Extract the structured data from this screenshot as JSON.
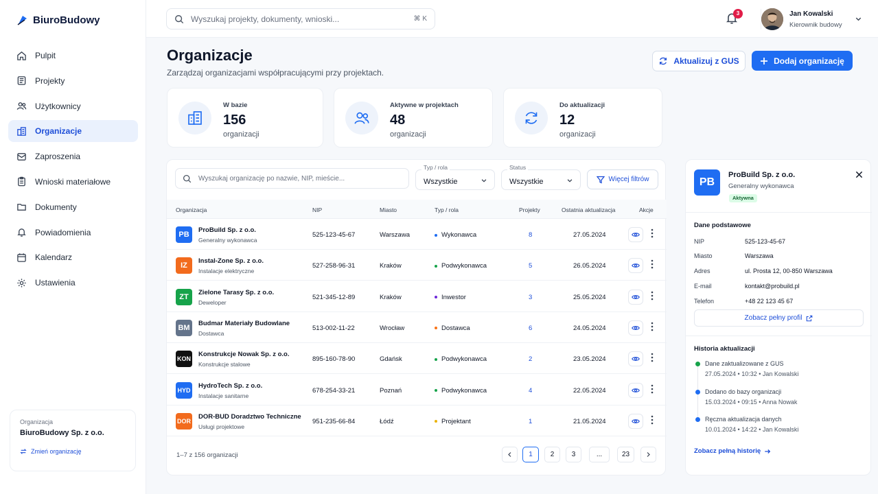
{
  "app": {
    "name": "BiuroBudowy"
  },
  "nav": {
    "items": [
      {
        "label": "Pulpit",
        "icon": "home-icon"
      },
      {
        "label": "Projekty",
        "icon": "projects-icon"
      },
      {
        "label": "Użytkownicy",
        "icon": "users-icon"
      },
      {
        "label": "Organizacje",
        "icon": "building-icon",
        "active": true
      },
      {
        "label": "Zaproszenia",
        "icon": "mail-icon"
      },
      {
        "label": "Wnioski materiałowe",
        "icon": "clipboard-icon"
      },
      {
        "label": "Dokumenty",
        "icon": "folder-icon"
      },
      {
        "label": "Powiadomienia",
        "icon": "bell-icon"
      },
      {
        "label": "Kalendarz",
        "icon": "calendar-icon"
      },
      {
        "label": "Ustawienia",
        "icon": "gear-icon"
      }
    ]
  },
  "org_switcher": {
    "label": "Organizacja",
    "name": "BiuroBudowy Sp. z o.o.",
    "change_label": "Zmień organizację"
  },
  "topbar": {
    "search_placeholder": "Wyszukaj projekty, dokumenty, wnioski...",
    "shortcut": "⌘ K",
    "notifications_count": "3",
    "user_name": "Jan Kowalski",
    "user_role": "Kierownik budowy"
  },
  "page": {
    "title": "Organizacje",
    "subtitle": "Zarządzaj organizacjami współpracującymi przy projektach.",
    "btn_gus": "Aktualizuj z GUS",
    "btn_add": "Dodaj organizację"
  },
  "stats": [
    {
      "label": "W bazie",
      "value": "156",
      "unit": "organizacji",
      "icon": "building-icon"
    },
    {
      "label": "Aktywne w projektach",
      "value": "48",
      "unit": "organizacji",
      "icon": "users-icon"
    },
    {
      "label": "Do aktualizacji",
      "value": "12",
      "unit": "organizacji",
      "icon": "refresh-icon"
    }
  ],
  "filters": {
    "search_placeholder": "Wyszukaj organizację po nazwie, NIP, mieście...",
    "type_caption": "Typ / rola",
    "type_value": "Wszystkie",
    "status_caption": "Status",
    "status_value": "Wszystkie",
    "more_label": "Więcej filtrów"
  },
  "table": {
    "headers": {
      "org": "Organizacja",
      "nip": "NIP",
      "city": "Miasto",
      "type": "Typ / rola",
      "projects": "Projekty",
      "updated": "Ostatnia aktualizacja",
      "actions": "Akcje"
    },
    "rows": [
      {
        "abbr": "PB",
        "color": "#1f6df2",
        "name": "ProBuild Sp. z o.o.",
        "sub": "Generalny wykonawca",
        "nip": "525-123-45-67",
        "city": "Warszawa",
        "type": "Wykonawca",
        "dot": "#1f6df2",
        "projects": "8",
        "date": "27.05.2024"
      },
      {
        "abbr": "IZ",
        "color": "#f26b1d",
        "name": "Instal-Zone Sp. z o.o.",
        "sub": "Instalacje elektryczne",
        "nip": "527-258-96-31",
        "city": "Kraków",
        "type": "Podwykonawca",
        "dot": "#16a34a",
        "projects": "5",
        "date": "26.05.2024"
      },
      {
        "abbr": "ZT",
        "color": "#16a34a",
        "name": "Zielone Tarasy Sp. z o.o.",
        "sub": "Deweloper",
        "nip": "521-345-12-89",
        "city": "Kraków",
        "type": "Inwestor",
        "dot": "#6d28d9",
        "projects": "3",
        "date": "25.05.2024"
      },
      {
        "abbr": "BM",
        "color": "#64748b",
        "name": "Budmar Materiały Budowlane",
        "sub": "Dostawca",
        "nip": "513-002-11-22",
        "city": "Wrocław",
        "type": "Dostawca",
        "dot": "#f97316",
        "projects": "6",
        "date": "24.05.2024"
      },
      {
        "abbr": "KON",
        "color": "#111111",
        "name": "Konstrukcje Nowak Sp. z o.o.",
        "sub": "Konstrukcje stalowe",
        "nip": "895-160-78-90",
        "city": "Gdańsk",
        "type": "Podwykonawca",
        "dot": "#16a34a",
        "projects": "2",
        "date": "23.05.2024"
      },
      {
        "abbr": "HYD",
        "color": "#1f6df2",
        "name": "HydroTech Sp. z o.o.",
        "sub": "Instalacje sanitarne",
        "nip": "678-254-33-21",
        "city": "Poznań",
        "type": "Podwykonawca",
        "dot": "#16a34a",
        "projects": "4",
        "date": "22.05.2024"
      },
      {
        "abbr": "DOR",
        "color": "#f26b1d",
        "name": "DOR-BUD Doradztwo Techniczne",
        "sub": "Usługi projektowe",
        "nip": "951-235-66-84",
        "city": "Łódź",
        "type": "Projektant",
        "dot": "#eab308",
        "projects": "1",
        "date": "21.05.2024"
      }
    ]
  },
  "pagination": {
    "info": "1–7 z 156 organizacji",
    "pages": [
      "1",
      "2",
      "3",
      "...",
      "23"
    ]
  },
  "detail": {
    "abbr": "PB",
    "name": "ProBuild Sp. z o.o.",
    "sub": "Generalny wykonawca",
    "status": "Aktywna",
    "basic_title": "Dane podstawowe",
    "fields": [
      {
        "k": "NIP",
        "v": "525-123-45-67"
      },
      {
        "k": "Miasto",
        "v": "Warszawa"
      },
      {
        "k": "Adres",
        "v": "ul. Prosta 12, 00-850 Warszawa"
      },
      {
        "k": "E-mail",
        "v": "kontakt@probuild.pl"
      },
      {
        "k": "Telefon",
        "v": "+48 22 123 45 67"
      }
    ],
    "profile_label": "Zobacz pełny profil",
    "history_title": "Historia aktualizacji",
    "history": [
      {
        "title": "Dane zaktualizowane z GUS",
        "meta": "27.05.2024 • 10:32 • Jan Kowalski",
        "color": "#16a34a"
      },
      {
        "title": "Dodano do bazy organizacji",
        "meta": "15.03.2024 • 09:15 • Anna Nowak",
        "color": "#1f6df2"
      },
      {
        "title": "Ręczna aktualizacja danych",
        "meta": "10.01.2024 • 14:22 • Jan Kowalski",
        "color": "#1f6df2"
      }
    ],
    "history_link": "Zobacz pełną historię"
  }
}
